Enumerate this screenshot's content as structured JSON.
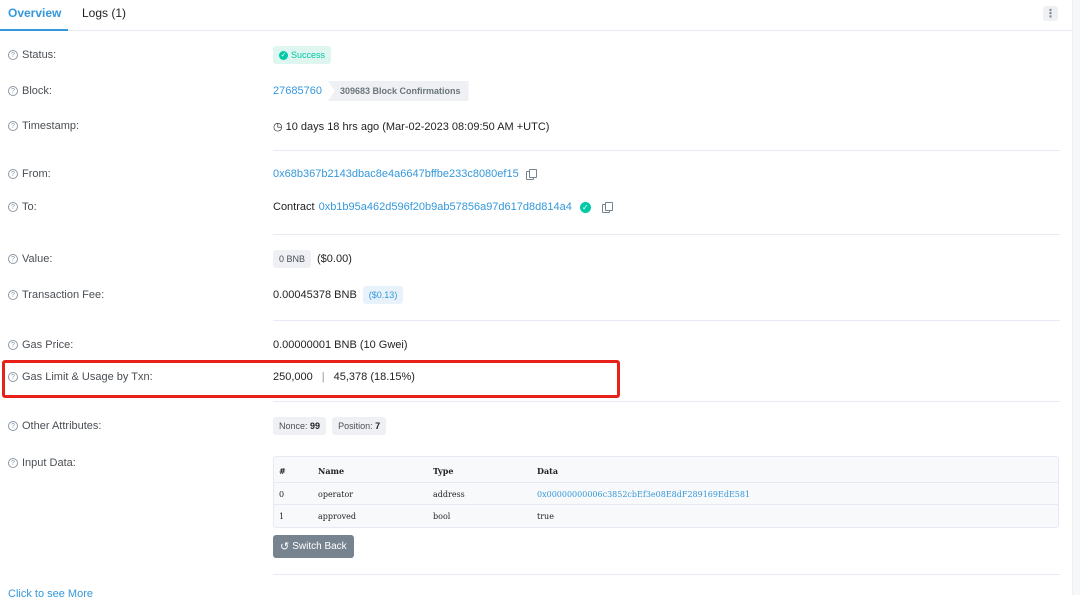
{
  "tabs": [
    {
      "label": "Overview",
      "active": true
    },
    {
      "label": "Logs (1)",
      "active": false
    }
  ],
  "menu_icon": "kebab-vertical-icon",
  "rows": {
    "status": {
      "label": "Status:",
      "value": "Success"
    },
    "block": {
      "label": "Block:",
      "number": "27685760",
      "confirmations": "309683 Block Confirmations"
    },
    "timestamp": {
      "label": "Timestamp:",
      "value": "10 days 18 hrs ago (Mar-02-2023 08:09:50 AM +UTC)"
    },
    "from": {
      "label": "From:",
      "address": "0x68b367b2143dbac8e4a6647bffbe233c8080ef15"
    },
    "to": {
      "label": "To:",
      "prefix": "Contract",
      "address": "0xb1b95a462d596f20b9ab57856a97d617d8d814a4"
    },
    "value": {
      "label": "Value:",
      "amount": "0 BNB",
      "usd": "($0.00)"
    },
    "fee": {
      "label": "Transaction Fee:",
      "amount": "0.00045378 BNB",
      "usd": "($0.13)"
    },
    "gas_price": {
      "label": "Gas Price:",
      "value": "0.00000001 BNB (10 Gwei)"
    },
    "gas_limit": {
      "label": "Gas Limit & Usage by Txn:",
      "limit": "250,000",
      "separator": "|",
      "usage": "45,378 (18.15%)"
    },
    "other": {
      "label": "Other Attributes:",
      "nonce_label": "Nonce:",
      "nonce": "99",
      "position_label": "Position:",
      "position": "7"
    },
    "input": {
      "label": "Input Data:"
    }
  },
  "input_table": {
    "headers": [
      "#",
      "Name",
      "Type",
      "Data"
    ],
    "rows": [
      [
        "0",
        "operator",
        "address",
        "0x00000000006c3852cbEf3e08E8dF289169EdE581"
      ],
      [
        "1",
        "approved",
        "bool",
        "true"
      ]
    ]
  },
  "switch_back": "Switch Back",
  "bottom_link": "Click to see More",
  "colors": {
    "accent": "#3498db",
    "success": "#00c9a7",
    "highlight_border": "#e8201a"
  }
}
